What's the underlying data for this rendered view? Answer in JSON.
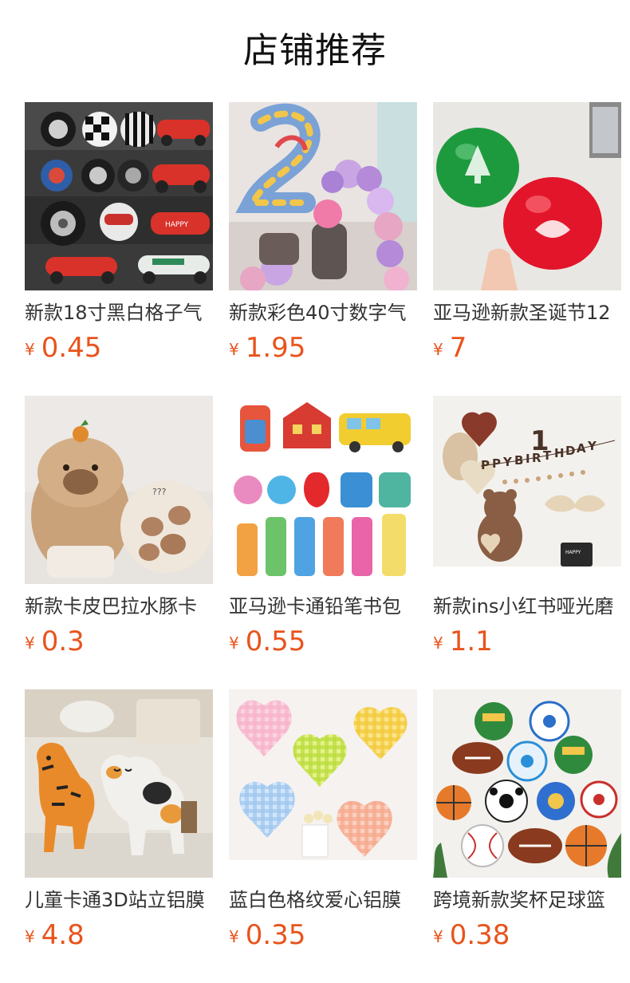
{
  "header": {
    "title": "店铺推荐"
  },
  "colors": {
    "price": "#e8541c",
    "title": "#111111",
    "text": "#333333"
  },
  "products": [
    {
      "name": "新款18寸黑白格子气",
      "currency": "¥",
      "price": "0.45",
      "image_icon": "racecar-tire-balloons-photo"
    },
    {
      "name": "新款彩色40寸数字气",
      "currency": "¥",
      "price": "1.95",
      "image_icon": "number-balloon-party-photo"
    },
    {
      "name": "亚马逊新款圣诞节12",
      "currency": "¥",
      "price": "7",
      "image_icon": "christmas-latex-balloons-photo"
    },
    {
      "name": "新款卡皮巴拉水豚卡",
      "currency": "¥",
      "price": "0.3",
      "image_icon": "capybara-balloons-photo"
    },
    {
      "name": "亚马逊卡通铅笔书包",
      "currency": "¥",
      "price": "0.55",
      "image_icon": "school-pencil-balloons-photo"
    },
    {
      "name": "新款ins小红书哑光磨",
      "currency": "¥",
      "price": "1.1",
      "image_icon": "birthday-bear-balloons-photo"
    },
    {
      "name": "儿童卡通3D站立铝膜",
      "currency": "¥",
      "price": "4.8",
      "image_icon": "standing-animal-balloons-photo"
    },
    {
      "name": "蓝白色格纹爱心铝膜",
      "currency": "¥",
      "price": "0.35",
      "image_icon": "plaid-heart-balloons-photo"
    },
    {
      "name": "跨境新款奖杯足球篮",
      "currency": "¥",
      "price": "0.38",
      "image_icon": "sports-ball-balloons-photo"
    }
  ]
}
